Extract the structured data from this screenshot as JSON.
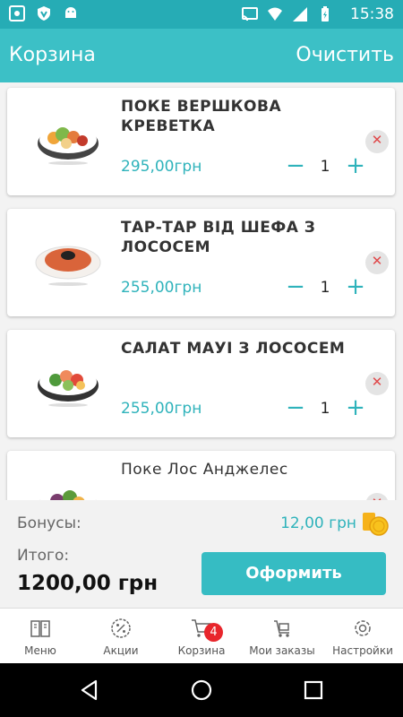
{
  "status_bar": {
    "time": "15:38"
  },
  "header": {
    "title": "Корзина",
    "clear_label": "Очистить"
  },
  "cart_items": [
    {
      "name": "ПОКЕ ВЕРШКОВА КРЕВЕТКА",
      "price": "295,00грн",
      "quantity": "1"
    },
    {
      "name": "ТАР-ТАР ВІД ШЕФА З ЛОСОСЕМ",
      "price": "255,00грн",
      "quantity": "1"
    },
    {
      "name": "САЛАТ МАУІ З ЛОСОСЕМ",
      "price": "255,00грн",
      "quantity": "1"
    },
    {
      "name": "Поке Лос Анджелес",
      "price": "",
      "quantity": ""
    }
  ],
  "controls": {
    "minus": "−",
    "plus": "+",
    "remove": "✕"
  },
  "summary": {
    "bonus_label": "Бонусы:",
    "bonus_value": "12,00 грн",
    "total_label": "Итого:",
    "total_value": "1200,00 грн",
    "checkout_label": "Оформить"
  },
  "bottom_nav": {
    "items": [
      {
        "label": "Меню",
        "icon": "menu-book-icon"
      },
      {
        "label": "Акции",
        "icon": "percent-badge-icon"
      },
      {
        "label": "Корзина",
        "icon": "cart-icon",
        "badge": "4"
      },
      {
        "label": "Мои заказы",
        "icon": "orders-cart-icon"
      },
      {
        "label": "Настройки",
        "icon": "gear-icon"
      }
    ]
  },
  "colors": {
    "accent": "#3cc0c6",
    "status_bar": "#26acb5",
    "remove": "#e0484a",
    "badge": "#e8262c"
  }
}
